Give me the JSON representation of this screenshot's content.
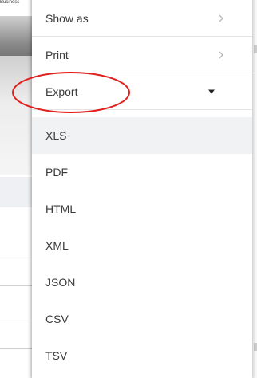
{
  "background": {
    "tiny_text": "Business"
  },
  "menu": {
    "items": [
      {
        "label": "Show as",
        "has_submenu": true,
        "icon": "chevron-right-icon"
      },
      {
        "label": "Print",
        "has_submenu": true,
        "icon": "chevron-right-icon"
      },
      {
        "label": "Export",
        "expanded": true,
        "icon": "caret-down-icon"
      }
    ],
    "export_options": [
      "XLS",
      "PDF",
      "HTML",
      "XML",
      "JSON",
      "CSV",
      "TSV"
    ],
    "hovered_option": "XLS"
  },
  "annotation": {
    "shape": "ellipse",
    "color": "#e0201e",
    "target": "Export"
  },
  "colors": {
    "menu_text": "#3a3a3a",
    "divider": "#e4e4e4",
    "hover_bg": "#f1f2f4",
    "chevron": "#b8b8b8"
  }
}
